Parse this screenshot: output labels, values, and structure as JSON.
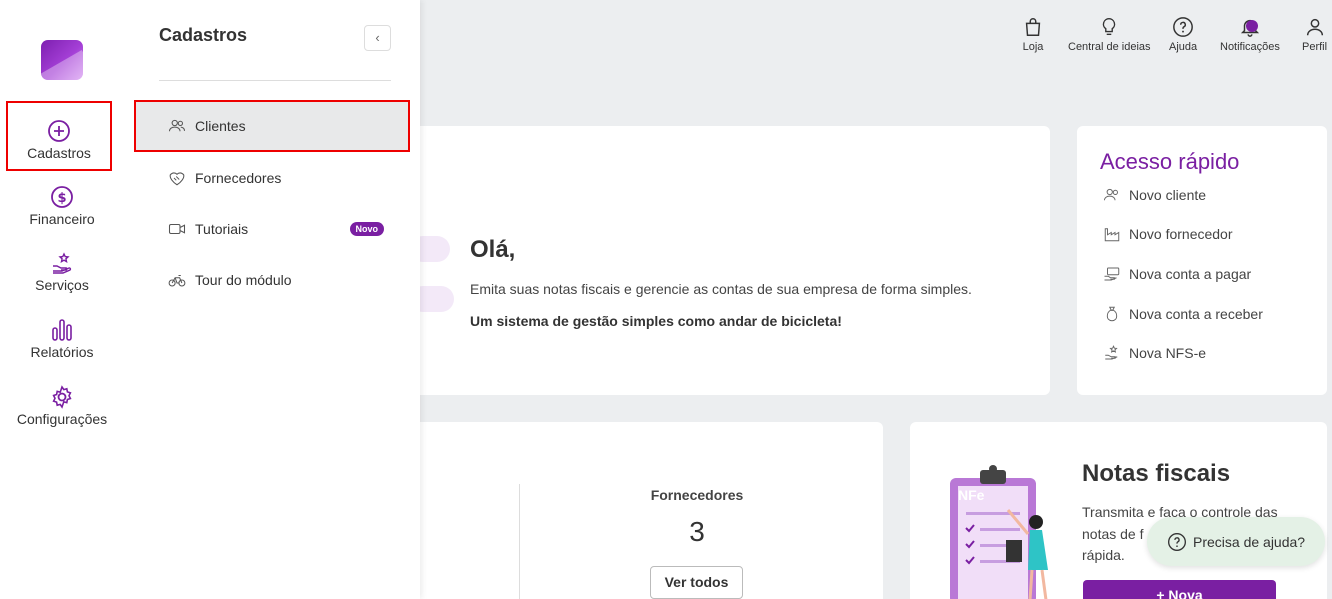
{
  "rail": {
    "items": [
      {
        "label": "Cadastros",
        "icon": "plus-circle-icon"
      },
      {
        "label": "Financeiro",
        "icon": "dollar-circle-icon"
      },
      {
        "label": "Serviços",
        "icon": "hand-star-icon"
      },
      {
        "label": "Relatórios",
        "icon": "bars-icon"
      },
      {
        "label": "Configurações",
        "icon": "gear-icon"
      }
    ]
  },
  "panel": {
    "title": "Cadastros",
    "collapse_icon": "chevron-left-icon",
    "items": [
      {
        "label": "Clientes",
        "icon": "users-icon"
      },
      {
        "label": "Fornecedores",
        "icon": "handshake-icon"
      },
      {
        "label": "Tutoriais",
        "icon": "video-icon",
        "badge": "Novo"
      },
      {
        "label": "Tour do módulo",
        "icon": "bicycle-icon"
      }
    ]
  },
  "topbar": {
    "items": [
      {
        "label": "Loja",
        "icon": "bag-icon"
      },
      {
        "label": "Central de ideias",
        "icon": "lightbulb-icon"
      },
      {
        "label": "Ajuda",
        "icon": "question-circle-icon"
      },
      {
        "label": "Notificações",
        "icon": "bell-icon"
      },
      {
        "label": "Perfil",
        "icon": "person-icon"
      }
    ]
  },
  "welcome": {
    "greeting": "Olá,",
    "text": "Emita suas notas fiscais e gerencie as contas de sua empresa de forma simples.",
    "tagline": "Um sistema de gestão simples como andar de bicicleta!"
  },
  "quick_access": {
    "title": "Acesso rápido",
    "items": [
      {
        "label": "Novo cliente",
        "icon": "users-icon"
      },
      {
        "label": "Novo fornecedor",
        "icon": "factory-icon"
      },
      {
        "label": "Nova conta a pagar",
        "icon": "money-hand-icon"
      },
      {
        "label": "Nova conta a receber",
        "icon": "money-bag-icon"
      },
      {
        "label": "Nova NFS-e",
        "icon": "hand-star-icon"
      }
    ]
  },
  "counters": {
    "label": "Fornecedores",
    "value": "3",
    "button": "Ver todos"
  },
  "invoices": {
    "title": "Notas fiscais",
    "line1": "Transmita e faca o controle das",
    "line2": "notas de f",
    "line3": "rápida.",
    "illustration_label": "NFe",
    "button": "+ Nova"
  },
  "help": {
    "label": "Precisa de ajuda?"
  },
  "colors": {
    "accent": "#7a1fa2",
    "highlight_border": "#e00000",
    "help_bg": "#e4f1e6"
  }
}
